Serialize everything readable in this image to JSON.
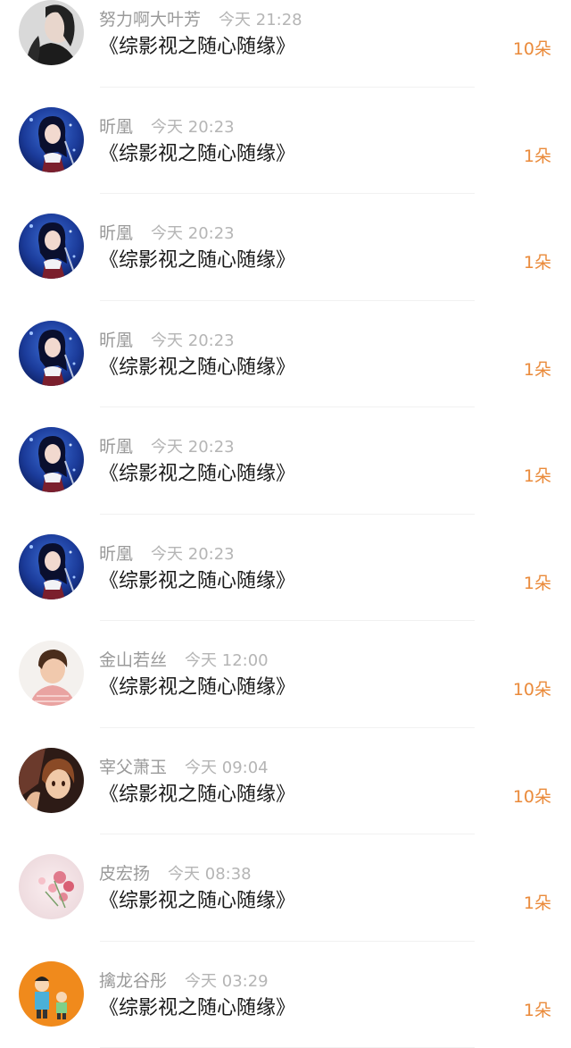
{
  "items": [
    {
      "user": "努力啊大叶芳",
      "time": "今天 21:28",
      "title": "《综影视之随心随缘》",
      "gift": "10朵",
      "avatar": "woman-portrait-avatar"
    },
    {
      "user": "昕凰",
      "time": "今天 20:23",
      "title": "《综影视之随心随缘》",
      "gift": "1朵",
      "avatar": "anime-girl-avatar"
    },
    {
      "user": "昕凰",
      "time": "今天 20:23",
      "title": "《综影视之随心随缘》",
      "gift": "1朵",
      "avatar": "anime-girl-avatar"
    },
    {
      "user": "昕凰",
      "time": "今天 20:23",
      "title": "《综影视之随心随缘》",
      "gift": "1朵",
      "avatar": "anime-girl-avatar"
    },
    {
      "user": "昕凰",
      "time": "今天 20:23",
      "title": "《综影视之随心随缘》",
      "gift": "1朵",
      "avatar": "anime-girl-avatar"
    },
    {
      "user": "昕凰",
      "time": "今天 20:23",
      "title": "《综影视之随心随缘》",
      "gift": "1朵",
      "avatar": "anime-girl-avatar"
    },
    {
      "user": "金山若丝",
      "time": "今天 12:00",
      "title": "《综影视之随心随缘》",
      "gift": "10朵",
      "avatar": "child-portrait-avatar"
    },
    {
      "user": "宰父萧玉",
      "time": "今天 09:04",
      "title": "《综影视之随心随缘》",
      "gift": "10朵",
      "avatar": "anime-boy-avatar"
    },
    {
      "user": "皮宏扬",
      "time": "今天 08:38",
      "title": "《综影视之随心随缘》",
      "gift": "1朵",
      "avatar": "flowers-avatar"
    },
    {
      "user": "擒龙谷彤",
      "time": "今天 03:29",
      "title": "《综影视之随心随缘》",
      "gift": "1朵",
      "avatar": "cartoon-family-avatar"
    }
  ],
  "colors": {
    "gift": "#ea8a3a",
    "username": "#9a9a9a",
    "title": "#1a1a1a",
    "divider": "#f1f1f1"
  }
}
